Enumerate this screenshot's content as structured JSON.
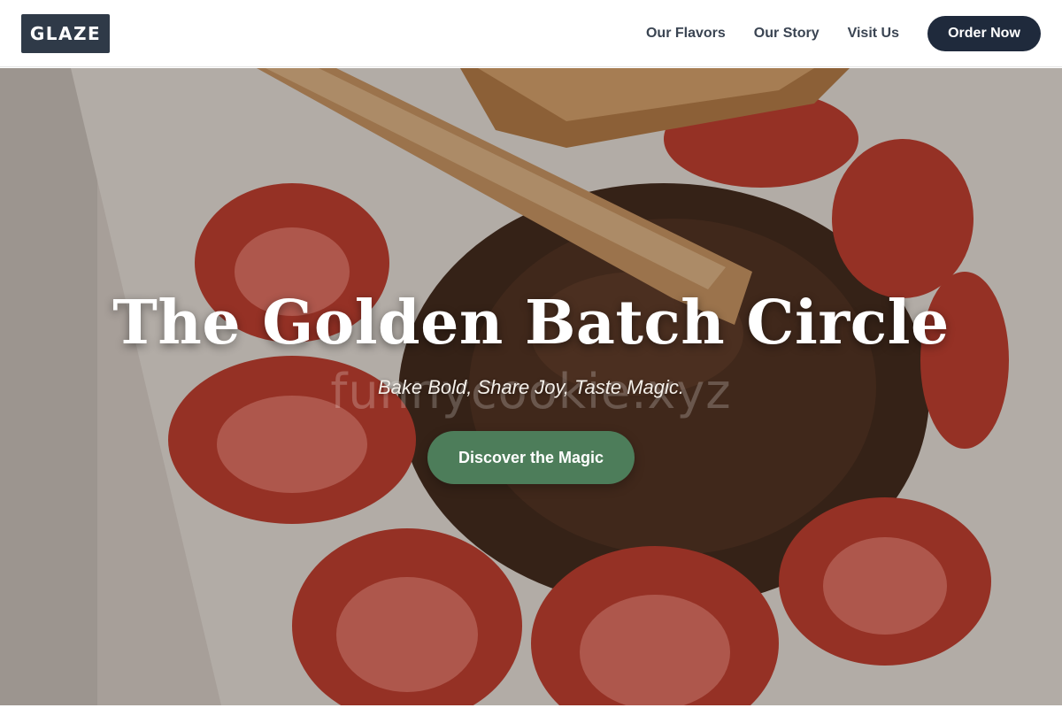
{
  "brand": {
    "logo_text": "GLAZE"
  },
  "nav": {
    "links": [
      {
        "label": "Our Flavors"
      },
      {
        "label": "Our Story"
      },
      {
        "label": "Visit Us"
      }
    ],
    "cta_label": "Order Now"
  },
  "hero": {
    "title": "The Golden Batch Circle",
    "subtitle": "Bake Bold, Share Joy, Taste Magic.",
    "watermark": "funnycookie.xyz",
    "button_label": "Discover the Magic",
    "image_subject": "churros with chocolate sauce and sliced strawberries"
  },
  "colors": {
    "header_bg": "#ffffff",
    "logo_bg": "#2f3a48",
    "nav_text": "#3a4452",
    "order_button_bg": "#1f2a3c",
    "cta_button_bg": "#4d7d5a",
    "title_text": "#ffffff"
  }
}
